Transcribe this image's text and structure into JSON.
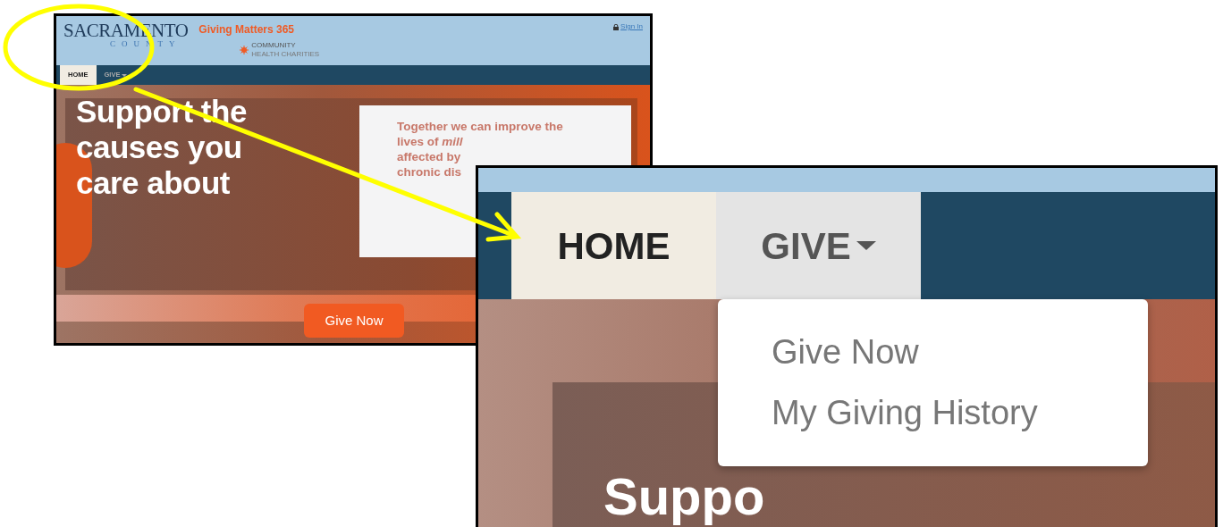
{
  "overview": {
    "header": {
      "logo_top": "SACRAMENTO",
      "logo_bottom": "COUNTY",
      "brand": "Giving Matters 365",
      "partner_top": "COMMUNITY",
      "partner_bottom": "HEALTH CHARITIES",
      "sign_in": "Sign In"
    },
    "nav": [
      {
        "label": "HOME",
        "selected": true,
        "expanded": false
      },
      {
        "label": "GIVE",
        "selected": false,
        "expanded": false
      }
    ],
    "hero": {
      "headline": [
        "Support the",
        "causes you",
        "care about"
      ],
      "message": [
        "Together we can improve the",
        "lives of **mill**",
        "affected by",
        "chronic dis"
      ],
      "button": "Give Now"
    }
  },
  "zoomed": {
    "nav": [
      {
        "label": "HOME",
        "selected": true,
        "expanded": false
      },
      {
        "label": "GIVE",
        "selected": false,
        "expanded": true
      }
    ],
    "menu": [
      "Give Now",
      "My Giving History"
    ],
    "hero_text": "Suppo"
  }
}
